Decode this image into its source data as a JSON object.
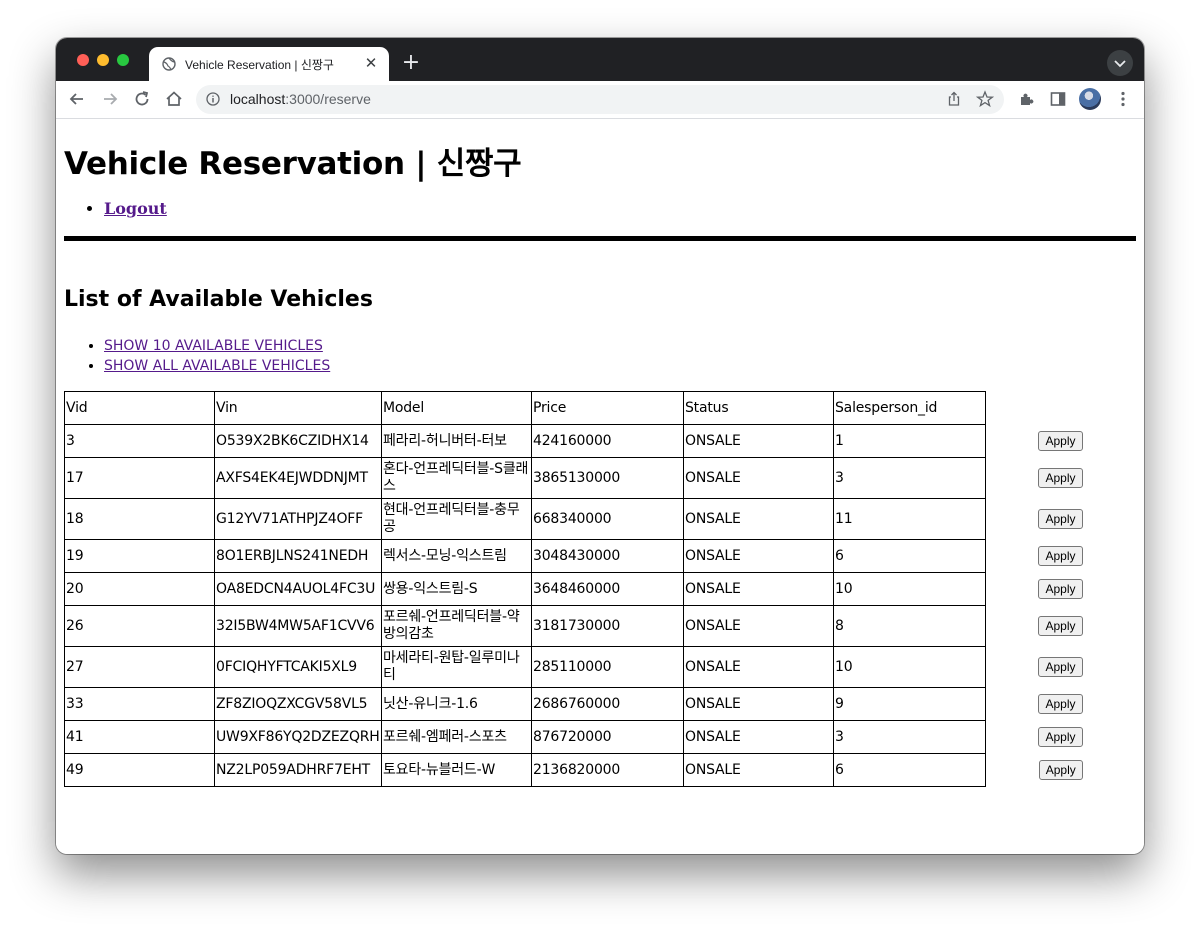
{
  "browser": {
    "tab_title": "Vehicle Reservation | 신짱구",
    "url_host": "localhost",
    "url_path": ":3000/reserve"
  },
  "page": {
    "title": "Vehicle Reservation | 신짱구",
    "logout": "Logout",
    "list_heading": "List of Available Vehicles",
    "show_10": "SHOW 10 AVAILABLE VEHICLES",
    "show_all": "SHOW ALL AVAILABLE VEHICLES"
  },
  "table": {
    "headers": [
      "Vid",
      "Vin",
      "Model",
      "Price",
      "Status",
      "Salesperson_id"
    ],
    "apply_label": "Apply",
    "rows": [
      [
        "3",
        "O539X2BK6CZIDHX14",
        "페라리-허니버터-터보",
        "424160000",
        "ONSALE",
        "1"
      ],
      [
        "17",
        "AXFS4EK4EJWDDNJMT",
        "혼다-언프레딕터블-S클래스",
        "3865130000",
        "ONSALE",
        "3"
      ],
      [
        "18",
        "G12YV71ATHPJZ4OFF",
        "현대-언프레딕터블-충무공",
        "668340000",
        "ONSALE",
        "11"
      ],
      [
        "19",
        "8O1ERBJLNS241NEDH",
        "렉서스-모닝-익스트림",
        "3048430000",
        "ONSALE",
        "6"
      ],
      [
        "20",
        "OA8EDCN4AUOL4FC3U",
        "쌍용-익스트림-S",
        "3648460000",
        "ONSALE",
        "10"
      ],
      [
        "26",
        "32I5BW4MW5AF1CVV6",
        "포르쉐-언프레딕터블-약방의감초",
        "3181730000",
        "ONSALE",
        "8"
      ],
      [
        "27",
        "0FCIQHYFTCAKI5XL9",
        "마세라티-원탑-일루미나티",
        "285110000",
        "ONSALE",
        "10"
      ],
      [
        "33",
        "ZF8ZIOQZXCGV58VL5",
        "닛산-유니크-1.6",
        "2686760000",
        "ONSALE",
        "9"
      ],
      [
        "41",
        "UW9XF86YQ2DZEZQRH",
        "포르쉐-엠페러-스포츠",
        "876720000",
        "ONSALE",
        "3"
      ],
      [
        "49",
        "NZ2LP059ADHRF7EHT",
        "토요타-뉴블러드-W",
        "2136820000",
        "ONSALE",
        "6"
      ]
    ]
  }
}
